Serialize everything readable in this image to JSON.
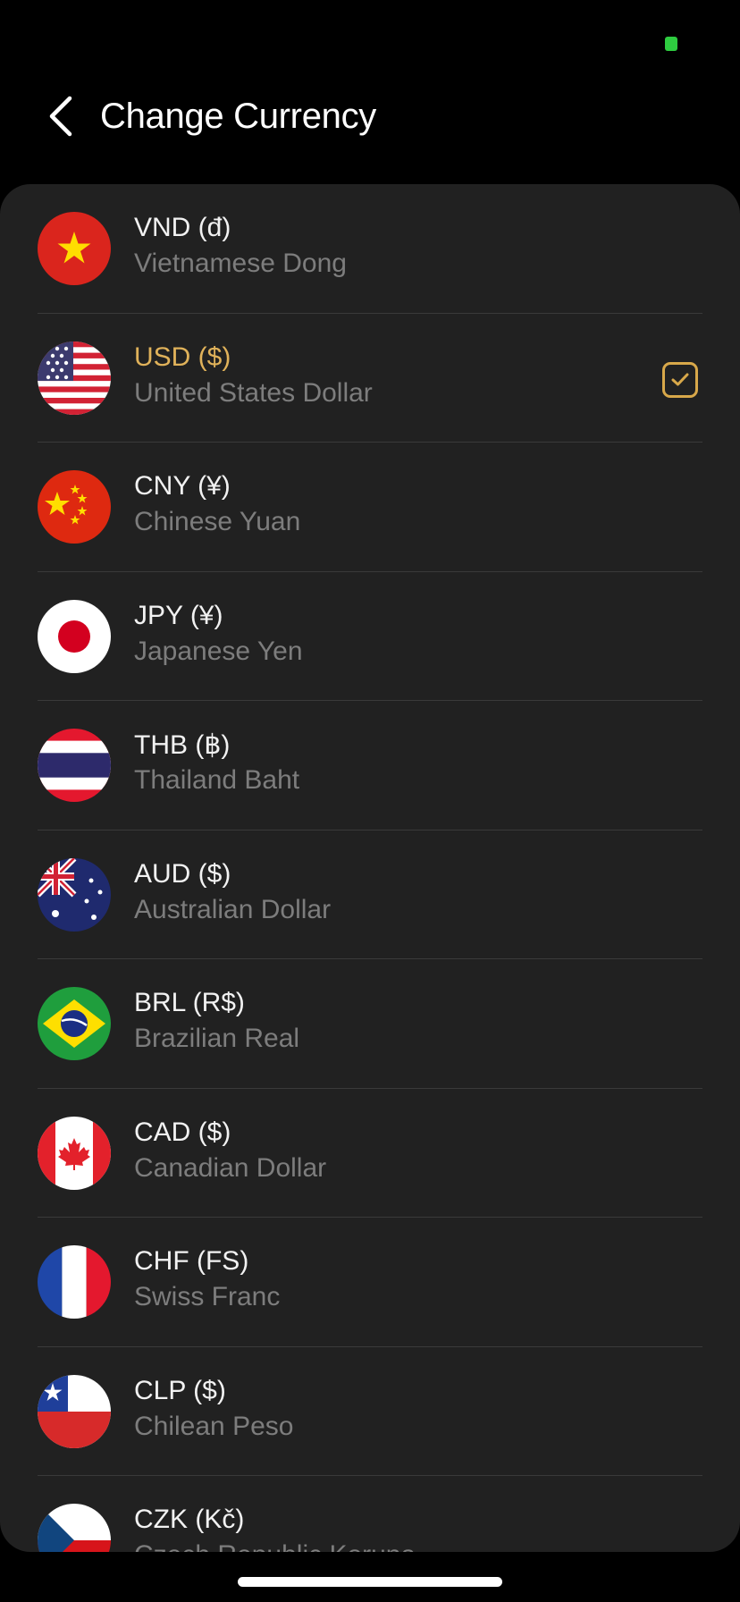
{
  "header": {
    "title": "Change Currency"
  },
  "currencies": [
    {
      "code": "VND (đ)",
      "name": "Vietnamese Dong",
      "flag": "vietnam-flag",
      "selected": false
    },
    {
      "code": "USD ($)",
      "name": "United States Dollar",
      "flag": "usa-flag",
      "selected": true
    },
    {
      "code": "CNY (¥)",
      "name": "Chinese Yuan",
      "flag": "china-flag",
      "selected": false
    },
    {
      "code": "JPY (¥)",
      "name": "Japanese Yen",
      "flag": "japan-flag",
      "selected": false
    },
    {
      "code": "THB (฿)",
      "name": "Thailand Baht",
      "flag": "thailand-flag",
      "selected": false
    },
    {
      "code": "AUD ($)",
      "name": "Australian Dollar",
      "flag": "australia-flag",
      "selected": false
    },
    {
      "code": "BRL (R$)",
      "name": "Brazilian Real",
      "flag": "brazil-flag",
      "selected": false
    },
    {
      "code": "CAD ($)",
      "name": "Canadian Dollar",
      "flag": "canada-flag",
      "selected": false
    },
    {
      "code": "CHF (FS)",
      "name": "Swiss Franc",
      "flag": "france-style-flag",
      "selected": false
    },
    {
      "code": "CLP ($)",
      "name": "Chilean Peso",
      "flag": "chile-flag",
      "selected": false
    },
    {
      "code": "CZK (Kč)",
      "name": "Czech Republic Koruna",
      "flag": "czech-flag",
      "selected": false
    }
  ],
  "colors": {
    "background": "#000000",
    "sheet": "#212121",
    "accent": "#e0b25a",
    "secondary_text": "#7d7d7d"
  }
}
